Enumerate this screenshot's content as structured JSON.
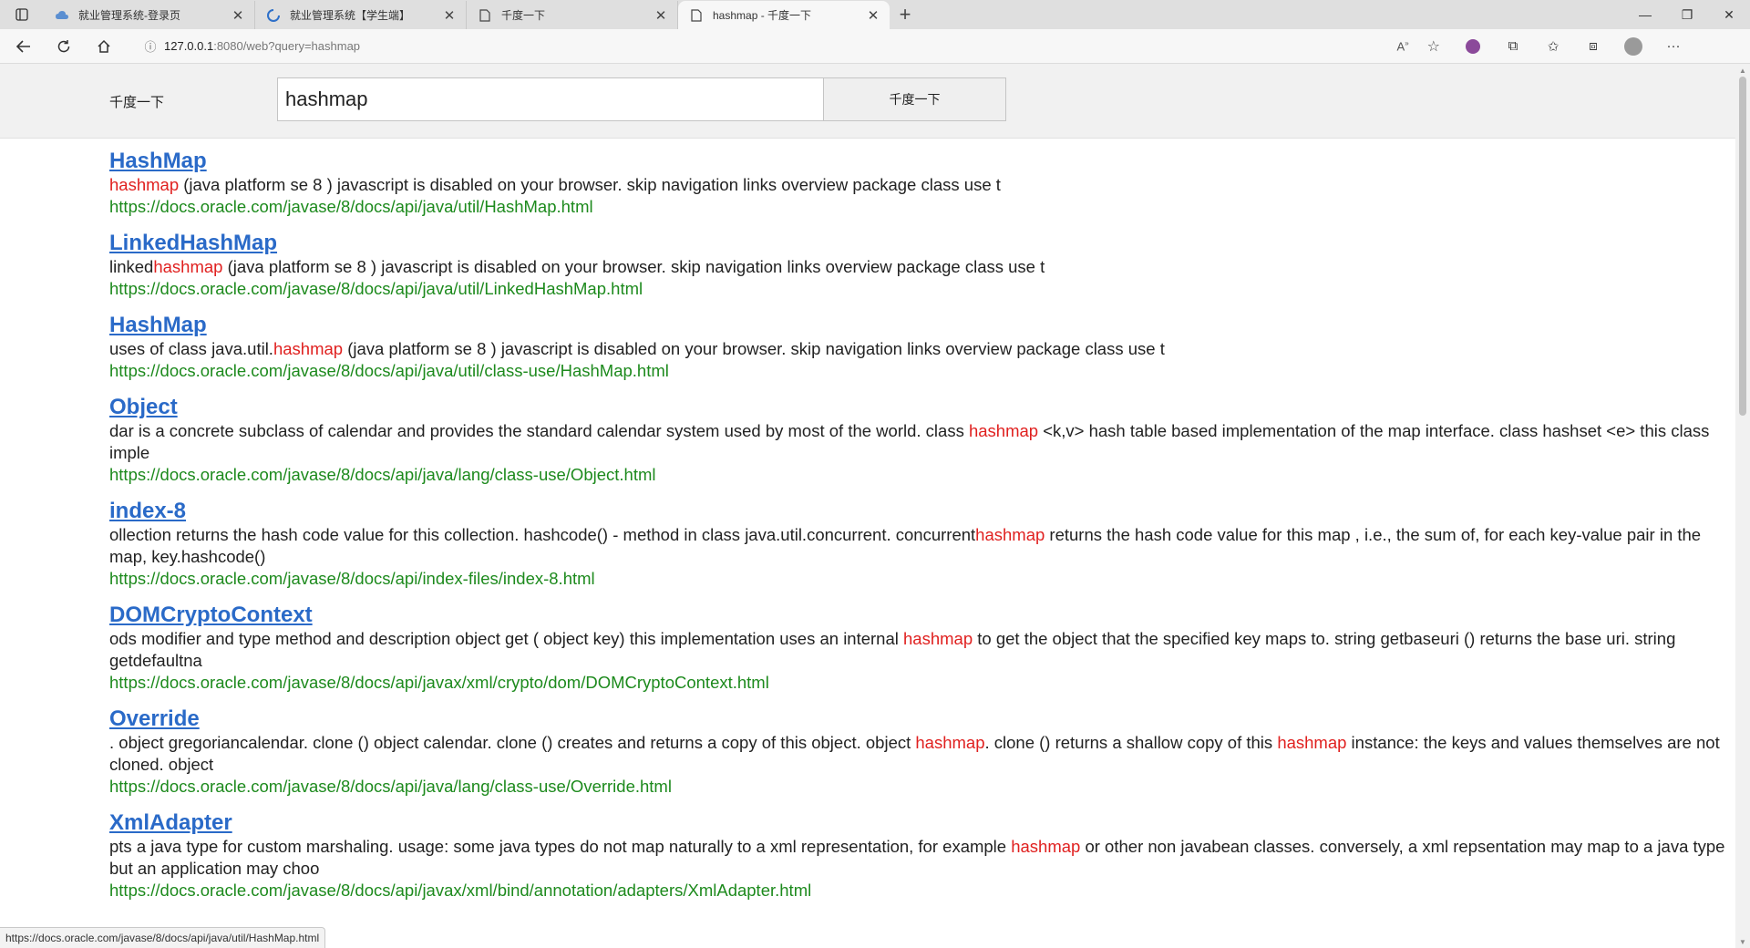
{
  "browser": {
    "tabs": [
      {
        "title": "就业管理系统-登录页",
        "icon": "cloud-icon"
      },
      {
        "title": "就业管理系统【学生端】",
        "icon": "loading-icon"
      },
      {
        "title": "千度一下",
        "icon": "page-icon"
      },
      {
        "title": "hashmap - 千度一下",
        "icon": "page-icon"
      }
    ],
    "address": {
      "host": "127.0.0.1",
      "rest": ":8080/web?query=hashmap"
    },
    "status_url": "https://docs.oracle.com/javase/8/docs/api/java/util/HashMap.html"
  },
  "header": {
    "logo": "千度一下",
    "search_value": "hashmap",
    "search_button": "千度一下"
  },
  "results": [
    {
      "title": "HashMap",
      "snippet": [
        {
          "t": "hashmap",
          "hl": true
        },
        {
          "t": " (java platform se 8 ) javascript is disabled on your browser. skip navigation links overview package class use t",
          "hl": false
        }
      ],
      "url": "https://docs.oracle.com/javase/8/docs/api/java/util/HashMap.html"
    },
    {
      "title": "LinkedHashMap",
      "snippet": [
        {
          "t": "linked",
          "hl": false
        },
        {
          "t": "hashmap",
          "hl": true
        },
        {
          "t": " (java platform se 8 ) javascript is disabled on your browser. skip navigation links overview package class use t",
          "hl": false
        }
      ],
      "url": "https://docs.oracle.com/javase/8/docs/api/java/util/LinkedHashMap.html"
    },
    {
      "title": "HashMap",
      "snippet": [
        {
          "t": "uses of class java.util.",
          "hl": false
        },
        {
          "t": "hashmap",
          "hl": true
        },
        {
          "t": " (java platform se 8 ) javascript is disabled on your browser. skip navigation links overview package class use t",
          "hl": false
        }
      ],
      "url": "https://docs.oracle.com/javase/8/docs/api/java/util/class-use/HashMap.html"
    },
    {
      "title": "Object",
      "snippet": [
        {
          "t": "dar is a concrete subclass of calendar and provides the standard calendar system used by most of the world. class  ",
          "hl": false
        },
        {
          "t": "hashmap",
          "hl": true
        },
        {
          "t": " <k,v> hash table based implementation of the map interface. class  hashset <e> this class imple",
          "hl": false
        }
      ],
      "url": "https://docs.oracle.com/javase/8/docs/api/java/lang/class-use/Object.html"
    },
    {
      "title": "index-8",
      "snippet": [
        {
          "t": "ollection returns the hash code value for this collection. hashcode() - method in class java.util.concurrent. concurrent",
          "hl": false
        },
        {
          "t": "hashmap",
          "hl": true
        },
        {
          "t": " returns the hash code value for this map , i.e., the sum of, for each key-value pair in the map, key.hashcode()",
          "hl": false
        }
      ],
      "url": "https://docs.oracle.com/javase/8/docs/api/index-files/index-8.html"
    },
    {
      "title": "DOMCryptoContext",
      "snippet": [
        {
          "t": "ods   modifier and type method and description object get ( object  key) this implementation uses an internal ",
          "hl": false
        },
        {
          "t": "hashmap",
          "hl": true
        },
        {
          "t": " to get the object that the specified key maps to. string getbaseuri () returns the base uri. string getdefaultna",
          "hl": false
        }
      ],
      "url": "https://docs.oracle.com/javase/8/docs/api/javax/xml/crypto/dom/DOMCryptoContext.html"
    },
    {
      "title": "Override",
      "snippet": [
        {
          "t": ". object gregoriancalendar. clone ()   object calendar. clone () creates and returns a copy of this object. object ",
          "hl": false
        },
        {
          "t": "hashmap",
          "hl": true
        },
        {
          "t": ". clone () returns a shallow copy of this ",
          "hl": false
        },
        {
          "t": "hashmap",
          "hl": true
        },
        {
          "t": " instance: the keys and values themselves are not cloned. object",
          "hl": false
        }
      ],
      "url": "https://docs.oracle.com/javase/8/docs/api/java/lang/class-use/Override.html"
    },
    {
      "title": "XmlAdapter",
      "snippet": [
        {
          "t": "pts a java type for custom marshaling. usage: some java types do not map naturally to a xml representation, for example ",
          "hl": false
        },
        {
          "t": "hashmap",
          "hl": true
        },
        {
          "t": " or other non javabean classes. conversely, a xml repsentation may map to a java type but an application may choo",
          "hl": false
        }
      ],
      "url": "https://docs.oracle.com/javase/8/docs/api/javax/xml/bind/annotation/adapters/XmlAdapter.html"
    }
  ],
  "colors": {
    "link": "#2a6ac8",
    "highlight": "#e0201f",
    "url": "#1d8a1d"
  }
}
